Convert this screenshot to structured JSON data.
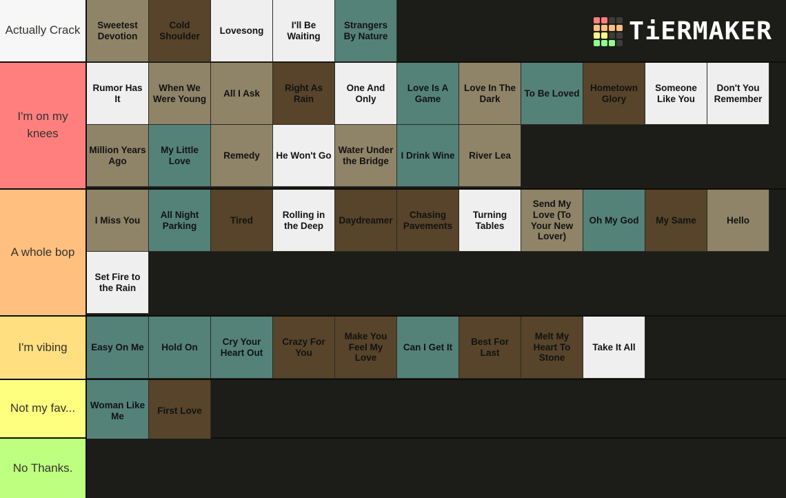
{
  "brand": {
    "name": "TiERMAKER",
    "logo_icon": "tiermaker-grid-icon",
    "logo_colors": {
      "red": "#ff7f7f",
      "orange": "#ffbf7f",
      "yellow": "#ffff7f",
      "green": "#8fff8f",
      "empty": "#3c3c38"
    },
    "logo_grid": [
      [
        "red",
        "red",
        "empty",
        "empty"
      ],
      [
        "orange",
        "orange",
        "orange",
        "orange"
      ],
      [
        "yellow",
        "yellow",
        "empty",
        "empty"
      ],
      [
        "green",
        "green",
        "green",
        "empty"
      ]
    ]
  },
  "palette": {
    "background": "#1c1c18",
    "tan": "#8f8468",
    "brown": "#57442a",
    "white": "#efefef",
    "teal": "#548279",
    "label_text": "#33322e",
    "tile_text": "#121212"
  },
  "tiers": [
    {
      "label": "Actually Crack",
      "label_color": "#f7f7f7",
      "tiles": [
        {
          "label": "Sweetest Devotion",
          "color": "#8f8468"
        },
        {
          "label": "Cold Shoulder",
          "color": "#57442a"
        },
        {
          "label": "Lovesong",
          "color": "#efefef"
        },
        {
          "label": "I'll Be Waiting",
          "color": "#efefef"
        },
        {
          "label": "Strangers By Nature",
          "color": "#548279"
        }
      ]
    },
    {
      "label": "I'm on my knees",
      "label_color": "#ff7f7f",
      "tiles": [
        {
          "label": "Rumor Has It",
          "color": "#efefef"
        },
        {
          "label": "When We Were Young",
          "color": "#8f8468"
        },
        {
          "label": "All I Ask",
          "color": "#8f8468"
        },
        {
          "label": "Right As Rain",
          "color": "#57442a"
        },
        {
          "label": "One And Only",
          "color": "#efefef"
        },
        {
          "label": "Love Is A Game",
          "color": "#548279"
        },
        {
          "label": "Love In The Dark",
          "color": "#8f8468"
        },
        {
          "label": "To Be Loved",
          "color": "#548279"
        },
        {
          "label": "Hometown Glory",
          "color": "#57442a"
        },
        {
          "label": "Someone Like You",
          "color": "#efefef"
        },
        {
          "label": "Don't You Remember",
          "color": "#efefef"
        },
        {
          "label": "Million Years Ago",
          "color": "#8f8468"
        },
        {
          "label": "My Little Love",
          "color": "#548279"
        },
        {
          "label": "Remedy",
          "color": "#8f8468"
        },
        {
          "label": "He Won't Go",
          "color": "#efefef"
        },
        {
          "label": "Water Under the Bridge",
          "color": "#8f8468"
        },
        {
          "label": "I Drink Wine",
          "color": "#548279"
        },
        {
          "label": "River Lea",
          "color": "#8f8468"
        }
      ]
    },
    {
      "label": "A whole bop",
      "label_color": "#ffbf7f",
      "tiles": [
        {
          "label": "I Miss You",
          "color": "#8f8468"
        },
        {
          "label": "All Night Parking",
          "color": "#548279"
        },
        {
          "label": "Tired",
          "color": "#57442a"
        },
        {
          "label": "Rolling in the Deep",
          "color": "#efefef"
        },
        {
          "label": "Daydreamer",
          "color": "#57442a"
        },
        {
          "label": "Chasing Pavements",
          "color": "#57442a"
        },
        {
          "label": "Turning Tables",
          "color": "#efefef"
        },
        {
          "label": "Send My Love (To Your New Lover)",
          "color": "#8f8468"
        },
        {
          "label": "Oh My God",
          "color": "#548279"
        },
        {
          "label": "My Same",
          "color": "#57442a"
        },
        {
          "label": "Hello",
          "color": "#8f8468"
        },
        {
          "label": "Set Fire to the Rain",
          "color": "#efefef"
        }
      ]
    },
    {
      "label": "I'm vibing",
      "label_color": "#ffdf7f",
      "tiles": [
        {
          "label": "Easy On Me",
          "color": "#548279"
        },
        {
          "label": "Hold On",
          "color": "#548279"
        },
        {
          "label": "Cry Your Heart Out",
          "color": "#548279"
        },
        {
          "label": "Crazy For You",
          "color": "#57442a"
        },
        {
          "label": "Make You Feel My Love",
          "color": "#57442a"
        },
        {
          "label": "Can I Get It",
          "color": "#548279"
        },
        {
          "label": "Best For Last",
          "color": "#57442a"
        },
        {
          "label": "Melt My Heart To Stone",
          "color": "#57442a"
        },
        {
          "label": "Take It All",
          "color": "#efefef"
        }
      ]
    },
    {
      "label": "Not my fav...",
      "label_color": "#ffff7f",
      "tiles": [
        {
          "label": "Woman Like Me",
          "color": "#548279"
        },
        {
          "label": "First Love",
          "color": "#57442a"
        }
      ]
    },
    {
      "label": "No Thanks.",
      "label_color": "#bfff7f",
      "tiles": []
    }
  ]
}
